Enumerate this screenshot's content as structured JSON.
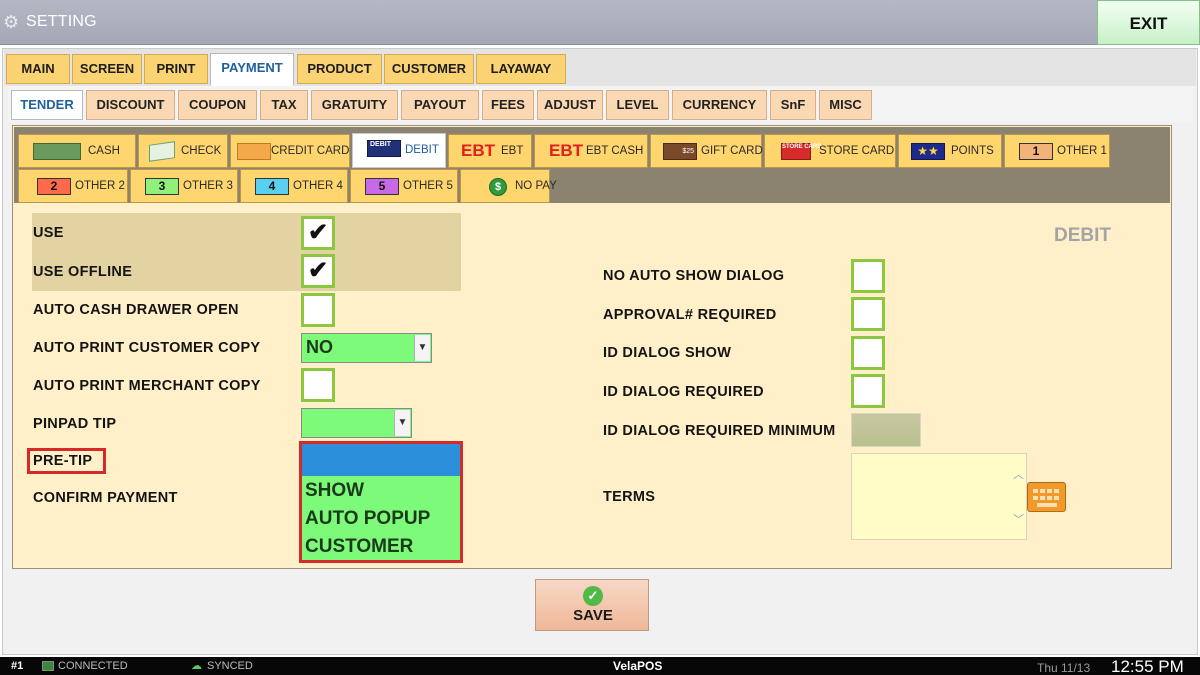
{
  "window": {
    "title": "SETTING",
    "exit_label": "EXIT"
  },
  "main_tabs": [
    "MAIN",
    "SCREEN",
    "PRINT",
    "PAYMENT",
    "PRODUCT",
    "CUSTOMER",
    "LAYAWAY"
  ],
  "sub_tabs": [
    "TENDER",
    "DISCOUNT",
    "COUPON",
    "TAX",
    "GRATUITY",
    "PAYOUT",
    "FEES",
    "ADJUST",
    "LEVEL",
    "CURRENCY",
    "SnF",
    "MISC"
  ],
  "tender_tabs": [
    "CASH",
    "CHECK",
    "CREDIT CARD",
    "DEBIT",
    "EBT",
    "EBT CASH",
    "GIFT CARD",
    "STORE CARD",
    "POINTS",
    "OTHER 1",
    "OTHER 2",
    "OTHER 3",
    "OTHER 4",
    "OTHER 5",
    "NO PAY"
  ],
  "tender_icon_text": {
    "debit": "DEBIT",
    "ebt": "EBT",
    "gift": "$25",
    "store": "STORE CARD",
    "points": "★★",
    "other1": "1",
    "other2": "2",
    "other3": "3",
    "other4": "4",
    "other5": "5",
    "nopay": "$"
  },
  "section_title": "DEBIT",
  "left_fields": {
    "use": {
      "label": "USE",
      "checked": true
    },
    "use_offline": {
      "label": "USE OFFLINE",
      "checked": true
    },
    "auto_cash_drawer_open": {
      "label": "AUTO CASH DRAWER OPEN",
      "checked": false
    },
    "auto_print_customer_copy": {
      "label": "AUTO PRINT CUSTOMER COPY",
      "value": "NO"
    },
    "auto_print_merchant_copy": {
      "label": "AUTO PRINT MERCHANT COPY",
      "checked": false
    },
    "pinpad_tip": {
      "label": "PINPAD TIP",
      "value": ""
    },
    "pre_tip": {
      "label": "PRE-TIP"
    },
    "confirm_payment": {
      "label": "CONFIRM PAYMENT"
    }
  },
  "dropdown_options": [
    "",
    "SHOW",
    "AUTO POPUP",
    "CUSTOMER"
  ],
  "right_fields": {
    "no_auto_show_dialog": {
      "label": "NO AUTO SHOW DIALOG",
      "checked": false
    },
    "approval_required": {
      "label": "APPROVAL# REQUIRED",
      "checked": false
    },
    "id_dialog_show": {
      "label": "ID DIALOG SHOW",
      "checked": false
    },
    "id_dialog_required": {
      "label": "ID DIALOG REQUIRED",
      "checked": false
    },
    "id_dialog_required_minimum": {
      "label": "ID DIALOG REQUIRED MINIMUM"
    },
    "terms": {
      "label": "TERMS",
      "value": ""
    }
  },
  "save_label": "SAVE",
  "taskbar": {
    "terminal": "#1",
    "connection": "CONNECTED",
    "sync": "SYNCED",
    "brand": "VelaPOS",
    "date": "Thu 11/13",
    "time": "12:55 PM"
  },
  "colors": {
    "tab": "#fbd373",
    "subtab": "#fad8b3",
    "content_bg": "#fff0c9",
    "checkbox_border": "#8dc63f",
    "dropdown": "#7dfa7a",
    "highlight": "#2c8fdc",
    "annotation_red": "#d42a2a"
  },
  "icons": [
    "gear-icon",
    "keyboard-icon",
    "check-circle-icon",
    "connected-icon",
    "cloud-icon"
  ]
}
